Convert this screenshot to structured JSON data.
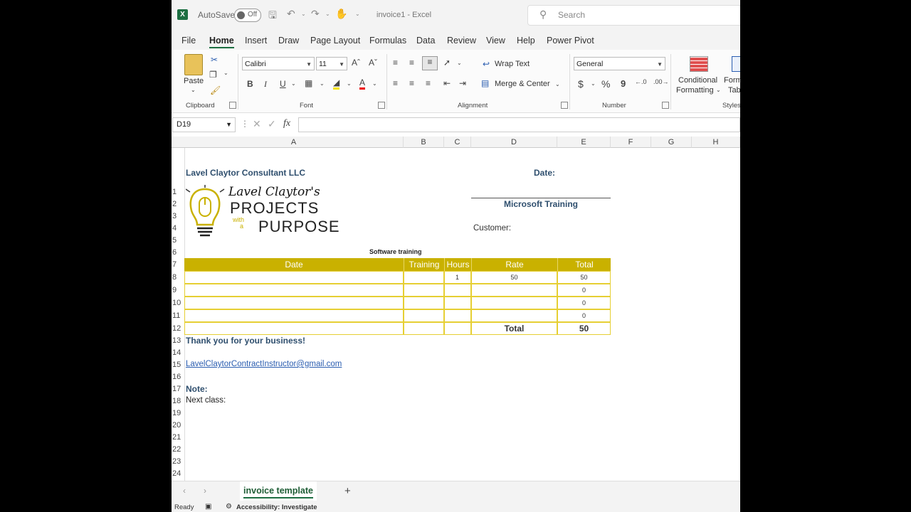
{
  "titlebar": {
    "autosave_label": "AutoSave",
    "autosave_state": "Off",
    "doc_title": "invoice1  -  Excel",
    "search_placeholder": "Search"
  },
  "menu": {
    "tabs": [
      "File",
      "Home",
      "Insert",
      "Draw",
      "Page Layout",
      "Formulas",
      "Data",
      "Review",
      "View",
      "Help",
      "Power Pivot"
    ],
    "active": "Home"
  },
  "ribbon": {
    "clipboard": {
      "paste_label": "Paste",
      "group_label": "Clipboard"
    },
    "font": {
      "font_name": "Calibri",
      "font_size": "11",
      "bold": "B",
      "italic": "I",
      "underline": "U",
      "group_label": "Font"
    },
    "alignment": {
      "wrap_text": "Wrap Text",
      "merge_center": "Merge & Center",
      "group_label": "Alignment"
    },
    "number": {
      "format": "General",
      "currency": "$",
      "percent": "%",
      "comma": "9",
      "inc_decimal": ".0\n.00",
      "group_label": "Number"
    },
    "styles": {
      "conditional_1": "Conditional",
      "conditional_2": "Formatting",
      "format_table_1": "Form",
      "format_table_2": "Tab",
      "group_label": "Styles"
    }
  },
  "formula_bar": {
    "name_box": "D19",
    "fx": "fx",
    "content": ""
  },
  "columns": [
    "A",
    "B",
    "C",
    "D",
    "E",
    "F",
    "G",
    "H"
  ],
  "rows": [
    "1",
    "2",
    "3",
    "4",
    "5",
    "6",
    "7",
    "8",
    "9",
    "10",
    "11",
    "12",
    "13",
    "14",
    "15",
    "16",
    "17",
    "18",
    "19",
    "20",
    "21",
    "22",
    "23",
    "24"
  ],
  "sheet": {
    "company": "Lavel Claytor Consultant LLC",
    "date_label": "Date:",
    "training_title": "Microsoft  Training",
    "customer_label": "Customer:",
    "logo": {
      "script_line": "Lavel Claytor's",
      "line2": "PROJECTS",
      "with": "with",
      "a": "a",
      "line3": "PURPOSE"
    },
    "table_caption": "Software training",
    "table_headers": [
      "Date",
      "Training",
      "Hours",
      "Rate",
      "Total"
    ],
    "table_rows": [
      [
        "",
        "",
        "1",
        "50",
        "50"
      ],
      [
        "",
        "",
        "",
        "",
        "0"
      ],
      [
        "",
        "",
        "",
        "",
        "0"
      ],
      [
        "",
        "",
        "",
        "",
        "0"
      ]
    ],
    "total_label": "Total",
    "total_value": "50",
    "thanks": "Thank you for your business!",
    "email": "LavelClaytorContractInstructor@gmail.com",
    "note_label": "Note:",
    "next_class": "Next class:"
  },
  "sheet_tabs": {
    "active": "invoice template",
    "add": "+"
  },
  "status": {
    "ready": "Ready",
    "accessibility": "Accessibility: Investigate"
  },
  "colors": {
    "accent_green": "#1d6f42",
    "table_gold": "#c9b100",
    "text_blue": "#2f4f6e"
  }
}
